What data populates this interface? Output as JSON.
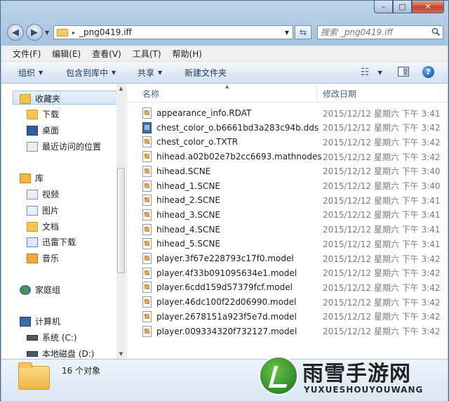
{
  "window": {
    "caption": {
      "minimize": "–",
      "maximize": "□",
      "close": "✕"
    }
  },
  "address": {
    "path_arrow": "▸",
    "path": "_png0419.iff",
    "search_placeholder": "搜索 _png0419.iff"
  },
  "menu": [
    "文件(F)",
    "编辑(E)",
    "查看(V)",
    "工具(T)",
    "帮助(H)"
  ],
  "toolbar": {
    "organize": "组织",
    "include_library": "包含到库中",
    "share": "共享",
    "new_folder": "新建文件夹",
    "view_icon": "☷",
    "help": "?"
  },
  "nav": {
    "favorites": "收藏夹",
    "downloads": "下载",
    "desktop": "桌面",
    "recent": "最近访问的位置",
    "libraries": "库",
    "videos": "视频",
    "pictures": "图片",
    "documents": "文档",
    "thunder": "迅雷下载",
    "music": "音乐",
    "homegroup": "家庭组",
    "computer": "计算机",
    "drive_c": "系统 (C:)",
    "drive_d": "本地磁盘 (D:)"
  },
  "columns": {
    "name": "名称",
    "modified": "修改日期"
  },
  "files": [
    {
      "name": "appearance_info.RDAT",
      "date": "2015/12/12 星期六 下午 3:41",
      "icon": "generic"
    },
    {
      "name": "chest_color_o.b6661bd3a283c94b.dds",
      "date": "2015/12/12 星期六 下午 3:42",
      "icon": "dds"
    },
    {
      "name": "chest_color_o.TXTR",
      "date": "2015/12/12 星期六 下午 3:42",
      "icon": "generic"
    },
    {
      "name": "hihead.a02b02e7b2cc6693.mathnodes",
      "date": "2015/12/12 星期六 下午 3:42",
      "icon": "generic"
    },
    {
      "name": "hihead.SCNE",
      "date": "2015/12/12 星期六 下午 3:40",
      "icon": "generic"
    },
    {
      "name": "hihead_1.SCNE",
      "date": "2015/12/12 星期六 下午 3:40",
      "icon": "generic"
    },
    {
      "name": "hihead_2.SCNE",
      "date": "2015/12/12 星期六 下午 3:41",
      "icon": "generic"
    },
    {
      "name": "hihead_3.SCNE",
      "date": "2015/12/12 星期六 下午 3:41",
      "icon": "generic"
    },
    {
      "name": "hihead_4.SCNE",
      "date": "2015/12/12 星期六 下午 3:41",
      "icon": "generic"
    },
    {
      "name": "hihead_5.SCNE",
      "date": "2015/12/12 星期六 下午 3:41",
      "icon": "generic"
    },
    {
      "name": "player.3f67e228793c17f0.model",
      "date": "2015/12/12 星期六 下午 3:42",
      "icon": "generic"
    },
    {
      "name": "player.4f33b091095634e1.model",
      "date": "2015/12/12 星期六 下午 3:42",
      "icon": "generic"
    },
    {
      "name": "player.6cdd159d57379fcf.model",
      "date": "2015/12/12 星期六 下午 3:42",
      "icon": "generic"
    },
    {
      "name": "player.46dc100f22d06990.model",
      "date": "2015/12/12 星期六 下午 3:42",
      "icon": "generic"
    },
    {
      "name": "player.2678151a923f5e7d.model",
      "date": "2015/12/12 星期六 下午 3:42",
      "icon": "generic"
    },
    {
      "name": "player.009334320f732127.model",
      "date": "2015/12/12 星期六 下午 3:42",
      "icon": "generic"
    }
  ],
  "status": {
    "count": "16 个对象"
  },
  "watermark": {
    "title": "雨雪手游网",
    "subtitle": "YUXUESHOUYOUWANG"
  }
}
